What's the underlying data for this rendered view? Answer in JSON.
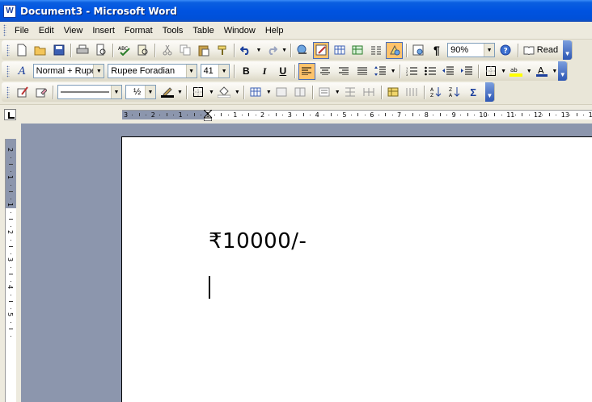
{
  "window": {
    "title": "Document3 - Microsoft Word",
    "app_icon_letter": "W"
  },
  "menu": {
    "items": [
      "File",
      "Edit",
      "View",
      "Insert",
      "Format",
      "Tools",
      "Table",
      "Window",
      "Help"
    ]
  },
  "standard_toolbar": {
    "zoom_value": "90%",
    "read_label": "Read",
    "icons": [
      "new-icon",
      "open-icon",
      "save-icon",
      "print-icon",
      "print-preview-icon",
      "spelling-icon",
      "research-icon",
      "cut-icon",
      "copy-icon",
      "paste-icon",
      "format-painter-icon",
      "undo-icon",
      "redo-icon",
      "hyperlink-icon",
      "tables-borders-icon",
      "insert-table-icon",
      "insert-excel-icon",
      "columns-icon",
      "drawing-icon",
      "document-map-icon",
      "show-hide-icon",
      "help-icon",
      "read-icon"
    ]
  },
  "formatting_toolbar": {
    "style_value": "Normal + Rupe",
    "font_value": "Rupee Foradian",
    "size_value": "41",
    "bold_label": "B",
    "italic_label": "I",
    "underline_label": "U"
  },
  "tables_toolbar": {
    "line_weight_value": "½"
  },
  "ruler": {
    "labels": [
      "3",
      "2",
      "1",
      "1",
      "1",
      "2",
      "3",
      "4",
      "5",
      "6",
      "7",
      "8",
      "9",
      "10",
      "11",
      "12",
      "13",
      "14"
    ],
    "vertical_labels": [
      "2",
      "1",
      "1",
      "2",
      "3",
      "4",
      "5"
    ]
  },
  "document": {
    "text": "₹10000/-"
  },
  "colors": {
    "titlebar": "#0053e0",
    "workspace": "#8c96ad",
    "active_button": "#ffc36b"
  }
}
